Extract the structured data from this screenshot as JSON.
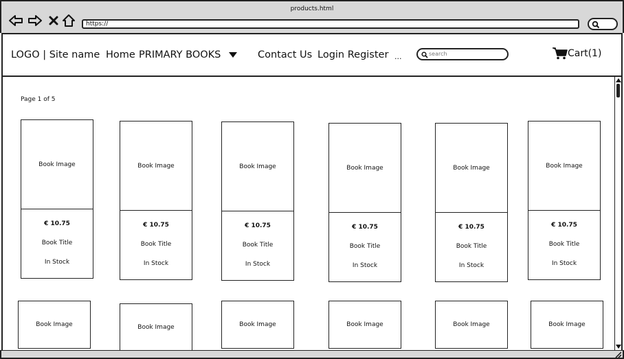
{
  "window": {
    "title": "products.html"
  },
  "browser": {
    "url": "https://"
  },
  "header": {
    "logo": "LOGO | Site name",
    "nav": {
      "home": "Home",
      "primary_books": "PRIMARY BOOKS",
      "contact": "Contact Us",
      "login_register": "Login Register",
      "more": "..."
    },
    "search_placeholder": "search",
    "cart": "Cart(1)"
  },
  "page": {
    "indicator": "Page 1 of 5"
  },
  "products_row1": [
    {
      "image": "Book Image",
      "price": "€ 10.75",
      "title": "Book Title",
      "stock": "In Stock"
    },
    {
      "image": "Book Image",
      "price": "€ 10.75",
      "title": "Book Title",
      "stock": "In Stock"
    },
    {
      "image": "Book Image",
      "price": "€ 10.75",
      "title": "Book Title",
      "stock": "In Stock"
    },
    {
      "image": "Book Image",
      "price": "€ 10.75",
      "title": "Book Title",
      "stock": "In Stock"
    },
    {
      "image": "Book Image",
      "price": "€ 10.75",
      "title": "Book Title",
      "stock": "In Stock"
    },
    {
      "image": "Book Image",
      "price": "€ 10.75",
      "title": "Book Title",
      "stock": "In Stock"
    }
  ],
  "products_row2": [
    {
      "image": "Book Image"
    },
    {
      "image": "Book Image"
    },
    {
      "image": "Book Image"
    },
    {
      "image": "Book Image"
    },
    {
      "image": "Book Image"
    },
    {
      "image": "Book Image"
    }
  ]
}
